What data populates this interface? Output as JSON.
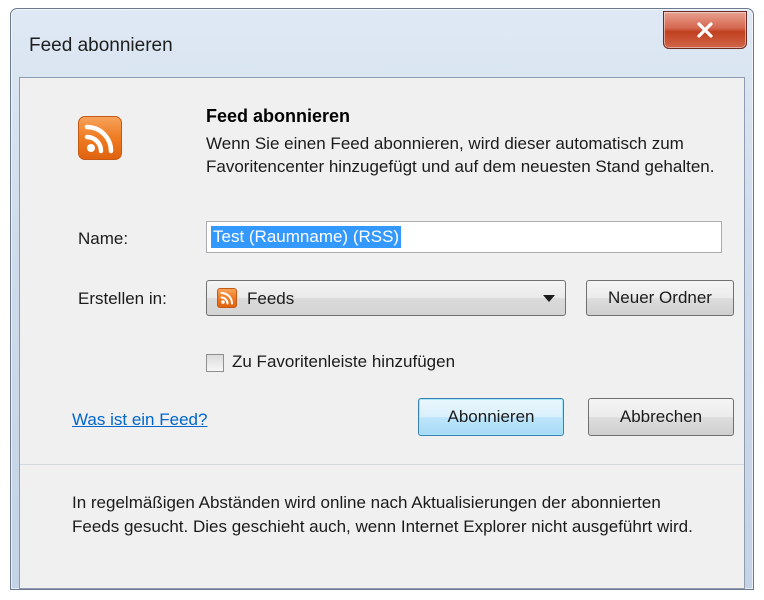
{
  "window": {
    "title": "Feed abonnieren"
  },
  "header": {
    "heading": "Feed abonnieren",
    "description": "Wenn Sie einen Feed abonnieren, wird dieser automatisch zum Favoritencenter hinzugefügt und auf dem neuesten Stand gehalten."
  },
  "form": {
    "name_label": "Name:",
    "name_value": "Test (Raumname) (RSS)",
    "create_in_label": "Erstellen in:",
    "create_in_value": "Feeds",
    "new_folder_button": "Neuer Ordner",
    "favorites_bar_checkbox": "Zu Favoritenleiste hinzufügen",
    "favorites_bar_checked": false
  },
  "actions": {
    "help_link": "Was ist ein Feed?",
    "subscribe_button": "Abonnieren",
    "cancel_button": "Abbrechen"
  },
  "footer": {
    "info_text": "In regelmäßigen Abständen wird online nach Aktualisierungen der abonnierten Feeds gesucht. Dies geschieht auch, wenn Internet Explorer nicht ausgeführt wird."
  },
  "icons": {
    "close": "close-icon",
    "rss": "rss-feed-icon",
    "dropdown": "chevron-down-icon"
  },
  "colors": {
    "rss_orange": "#ee7b22",
    "close_red": "#c0401f",
    "selection_blue": "#3399ff",
    "link_blue": "#0066cc"
  }
}
